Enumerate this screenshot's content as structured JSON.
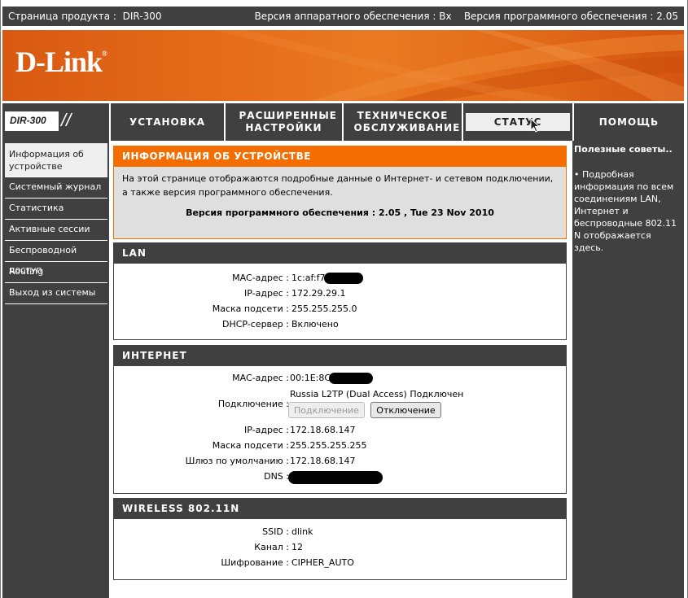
{
  "topbar": {
    "product_label": "Страница продукта :",
    "product": "DIR-300",
    "hardware": "Версия аппаратного обеспечения : Bx",
    "firmware": "Версия программного обеспечения : 2.05"
  },
  "brand": {
    "logo": "D-Link",
    "trademark": "®",
    "model": "DIR-300",
    "slashes": "//"
  },
  "nav": {
    "tabs": [
      {
        "label": "УСТАНОВКА"
      },
      {
        "label": "РАСШИРЕННЫЕ НАСТРОЙКИ"
      },
      {
        "label": "ТЕХНИЧЕСКОЕ ОБСЛУЖИВАНИЕ"
      },
      {
        "label": "СТАТУС"
      },
      {
        "label": "ПОМОЩЬ"
      }
    ]
  },
  "sidebar": {
    "items": [
      {
        "label": "Информация об устройстве"
      },
      {
        "label": "Системный журнал"
      },
      {
        "label": "Статистика"
      },
      {
        "label": "Активные сессии"
      },
      {
        "label": "Беспроводной доступ"
      },
      {
        "label": "Routing"
      },
      {
        "label": "Выход из системы"
      }
    ]
  },
  "help": {
    "title": "Полезные советы..",
    "tip": "•  Подробная информация по всем соединениям LAN, Интернет и беспроводные 802.11 N отображается здесь."
  },
  "info": {
    "title": "ИНФОРМАЦИЯ ОБ УСТРОЙСТВЕ",
    "desc": "На этой странице отображаются подробные данные о Интернет- и сетевом подключении, а также версия программного обеспечения.",
    "version": "Версия программного обеспечения : 2.05 ,  Tue 23 Nov 2010"
  },
  "lan": {
    "title": "LAN",
    "mac_label": "MAC-адрес :",
    "mac": "1c:af:f7",
    "ip_label": "IP-адрес :",
    "ip": "172.29.29.1",
    "mask_label": "Маска подсети :",
    "mask": "255.255.255.0",
    "dhcp_label": "DHCP-сервер :",
    "dhcp": "Включено"
  },
  "internet": {
    "title": "ИНТЕРНЕТ",
    "mac_label": "MAC-адрес :",
    "mac": "00:1E:8C",
    "conn_label": "Подключение :",
    "conn": "Russia L2TP (Dual Access)  Подключен",
    "connect_btn": "Подключение",
    "disconnect_btn": "Отключение",
    "ip_label": "IP-адрес :",
    "ip": "172.18.68.147",
    "mask_label": "Маска подсети :",
    "mask": "255.255.255.255",
    "gw_label": "Шлюз по умолчанию :",
    "gw": "172.18.68.147",
    "dns_label": "DNS :"
  },
  "wireless": {
    "title": "WIRELESS 802.11N",
    "ssid_label": "SSID :",
    "ssid": "dlink",
    "channel_label": "Канал :",
    "channel": "12",
    "enc_label": "Шифрование :",
    "enc": "CIPHER_AUTO"
  }
}
